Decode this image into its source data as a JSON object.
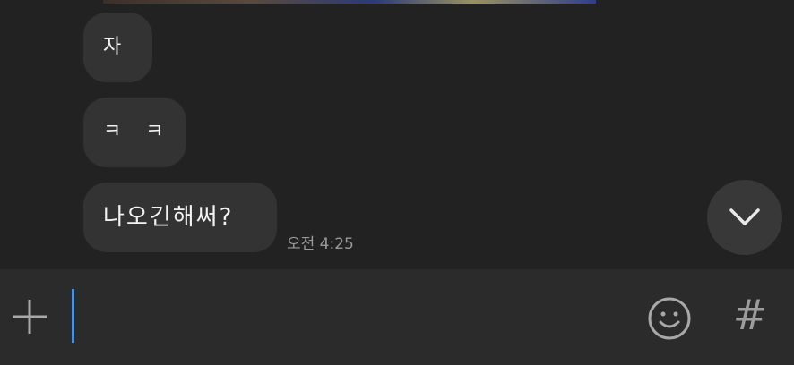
{
  "messages": [
    {
      "text": "자"
    },
    {
      "text": "ㅋ ㅋ"
    },
    {
      "text": "나오긴해써?"
    }
  ],
  "last_message_time": "오전 4:25",
  "composer": {
    "placeholder": "",
    "value": "",
    "hash_symbol": "#"
  },
  "icons": {
    "attach": "plus-icon",
    "emoji": "emoji-icon",
    "scroll": "chevron-down-icon",
    "tag": "hash-icon"
  },
  "colors": {
    "background": "#222222",
    "bubble": "#333333",
    "input_bar": "#2b2b2b",
    "caret": "#4a90d9",
    "timestamp": "#9a9a9a"
  }
}
